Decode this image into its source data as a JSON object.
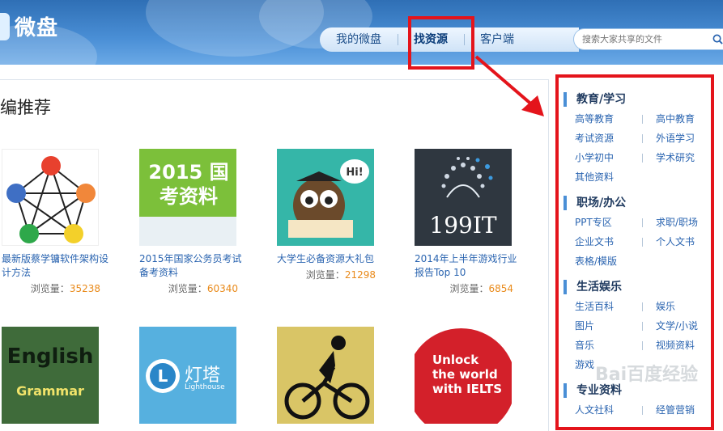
{
  "header": {
    "logo_text": "微盘",
    "nav": [
      {
        "label": "我的微盘"
      },
      {
        "label": "找资源"
      },
      {
        "label": "客户端"
      }
    ],
    "search": {
      "placeholder": "搜索大家共享的文件"
    }
  },
  "main": {
    "title": "编推荐",
    "cards": [
      {
        "title": "最新版蔡学镛软件架构设计方法",
        "views_label": "浏览量：",
        "views": "35238",
        "thumb_icon": "pentagon-graph-icon"
      },
      {
        "title": "2015年国家公务员考试备考资料",
        "views_label": "浏览量：",
        "views": "60340",
        "thumb_text": "2015 国考资料"
      },
      {
        "title": "大学生必备资源大礼包",
        "views_label": "浏览量：",
        "views": "21298",
        "thumb_icon": "owl-book-icon",
        "bubble": "Hi!"
      },
      {
        "title": "2014年上半年游戏行业报告Top 10",
        "views_label": "浏览量：",
        "views": "6854",
        "thumb_text": "199IT"
      },
      {
        "thumb_text_1": "English",
        "thumb_text_2": "Grammar"
      },
      {
        "thumb_text_1": "灯塔",
        "thumb_text_2": "Lighthouse"
      },
      {
        "thumb_icon": "cyclist-icon"
      },
      {
        "thumb_text_1": "Unlock",
        "thumb_text_2": "the world",
        "thumb_text_3": "with IELTS"
      }
    ]
  },
  "sidebar": {
    "categories": [
      {
        "title": "教育/学习",
        "links": [
          "高等教育",
          "高中教育",
          "考试资源",
          "外语学习",
          "小学初中",
          "学术研究",
          "其他资料"
        ]
      },
      {
        "title": "职场/办公",
        "links": [
          "PPT专区",
          "求职/职场",
          "企业文书",
          "个人文书",
          "表格/模版"
        ]
      },
      {
        "title": "生活娱乐",
        "links": [
          "生活百科",
          "娱乐",
          "图片",
          "文学/小说",
          "音乐",
          "视频资料",
          "游戏"
        ]
      },
      {
        "title": "专业资料",
        "links": [
          "人文社科",
          "经管营销"
        ]
      }
    ]
  },
  "watermark": "Bai百度经验",
  "colors": {
    "brand_blue": "#3a7fc8",
    "highlight_red": "#e4141b",
    "link_blue": "#2a64b0",
    "views_orange": "#e98a1a"
  }
}
